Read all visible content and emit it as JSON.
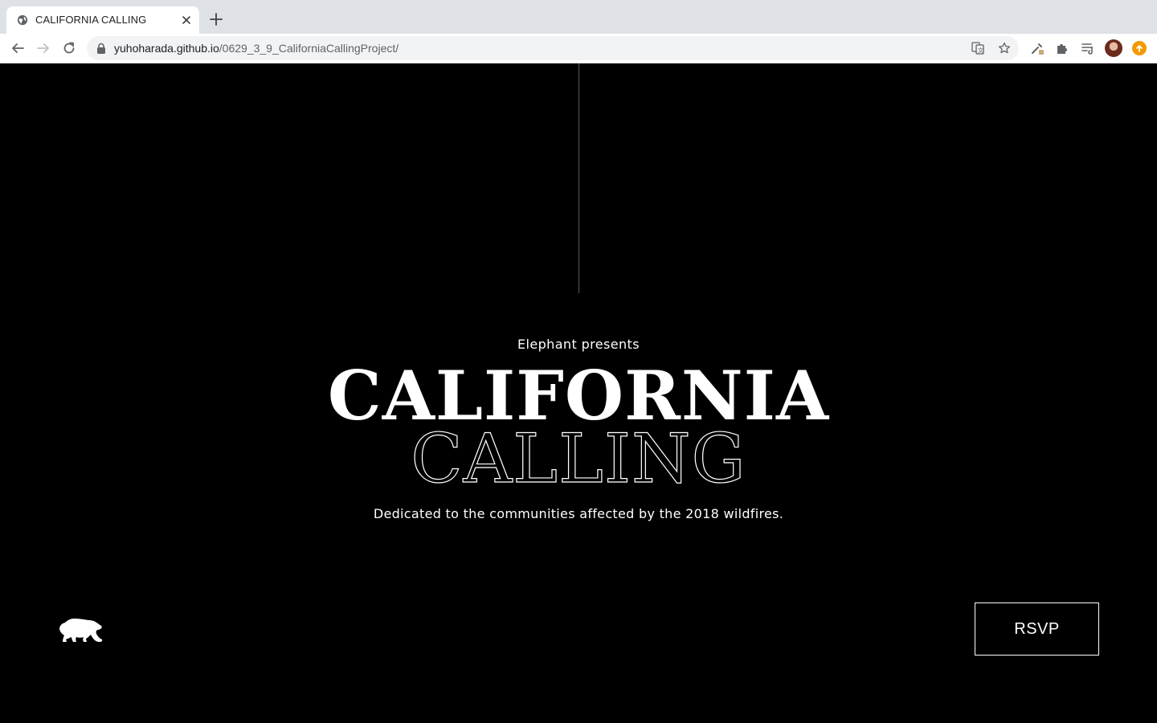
{
  "browser": {
    "tab": {
      "title": "CALIFORNIA CALLING",
      "favicon": "globe-icon"
    },
    "address_bar": {
      "domain": "yuhoharada.github.io",
      "path": "/0629_3_9_CaliforniaCallingProject/"
    },
    "icons": {
      "back": "back-arrow-icon",
      "forward": "forward-arrow-icon",
      "reload": "reload-icon",
      "lock": "lock-icon",
      "translate": "translate-icon",
      "bookmark": "star-icon",
      "extension_tool": "eyedropper-icon",
      "extensions": "puzzle-icon",
      "media": "media-queue-icon",
      "profile": "avatar",
      "update": "update-icon"
    },
    "colors": {
      "tabstrip": "#dee1e6",
      "update": "#f29900"
    }
  },
  "hero": {
    "presents": "Elephant presents",
    "title_line1": "CALIFORNIA",
    "title_line2": "CALLING",
    "dedication": "Dedicated to the communities affected by the 2018 wildfires."
  },
  "footer": {
    "logo": "bear-icon",
    "rsvp_label": "RSVP"
  },
  "colors": {
    "background": "#000000",
    "text": "#ffffff",
    "divider": "#5a5a5a"
  }
}
